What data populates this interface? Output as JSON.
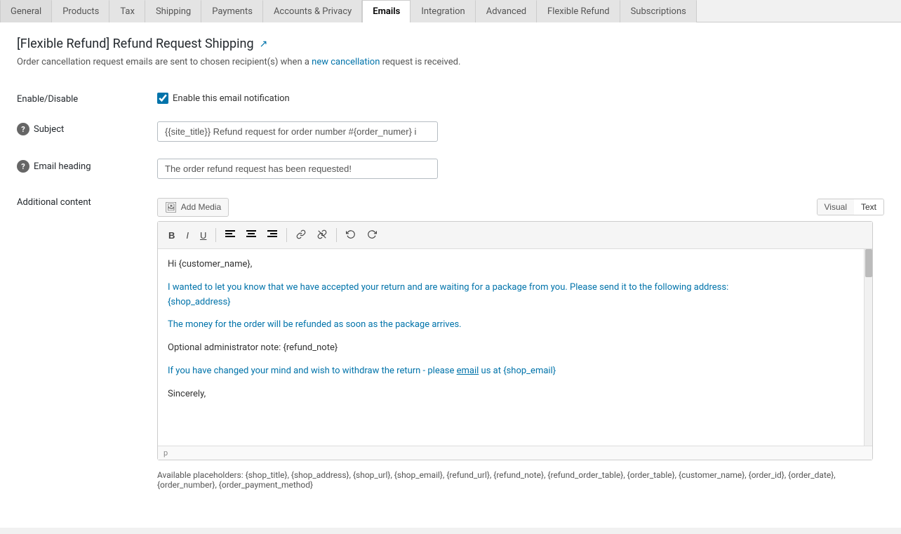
{
  "tabs": [
    {
      "id": "general",
      "label": "General",
      "active": false
    },
    {
      "id": "products",
      "label": "Products",
      "active": false
    },
    {
      "id": "tax",
      "label": "Tax",
      "active": false
    },
    {
      "id": "shipping",
      "label": "Shipping",
      "active": false
    },
    {
      "id": "payments",
      "label": "Payments",
      "active": false
    },
    {
      "id": "accounts-privacy",
      "label": "Accounts & Privacy",
      "active": false
    },
    {
      "id": "emails",
      "label": "Emails",
      "active": true
    },
    {
      "id": "integration",
      "label": "Integration",
      "active": false
    },
    {
      "id": "advanced",
      "label": "Advanced",
      "active": false
    },
    {
      "id": "flexible-refund",
      "label": "Flexible Refund",
      "active": false
    },
    {
      "id": "subscriptions",
      "label": "Subscriptions",
      "active": false
    }
  ],
  "page": {
    "title": "[Flexible Refund] Refund Request Shipping",
    "title_link_icon": "↗",
    "description": "Order cancellation request emails are sent to chosen recipient(s) when a new cancellation request is received."
  },
  "form": {
    "enable_disable": {
      "label": "Enable/Disable",
      "checkbox_label": "Enable this email notification",
      "checked": true
    },
    "subject": {
      "label": "Subject",
      "value": "{{site_title}} Refund request for order number #{order_numer} i",
      "placeholder": ""
    },
    "email_heading": {
      "label": "Email heading",
      "value": "The order refund request has been requested!",
      "placeholder": ""
    },
    "additional_content": {
      "label": "Additional content",
      "add_media_btn": "Add Media",
      "visual_tab": "Visual",
      "text_tab": "Text",
      "active_editor_tab": "Text",
      "editor_content": {
        "p1": "Hi {customer_name},",
        "p2": "I wanted to let you know that we have accepted your return and are waiting for a package from you. Please send it to the following address: {shop_address}",
        "p3": "The money for the order will be refunded as soon as the package arrives.",
        "p4": "Optional administrator note: {refund_note}",
        "p5": "If you have changed your mind and wish to withdraw the return - please email us at {shop_email}",
        "p6": "Sincerely,"
      },
      "status_bar": "p",
      "placeholders": "Available placeholders: {shop_title}, {shop_address}, {shop_url}, {shop_email}, {refund_url}, {refund_note}, {refund_order_table}, {order_table}, {customer_name}, {order_id}, {order_date}, {order_number}, {order_payment_method}"
    }
  },
  "toolbar": {
    "bold": "B",
    "italic": "I",
    "underline": "U",
    "align_left": "≡",
    "align_center": "≡",
    "align_right": "≡",
    "link": "🔗",
    "unlink": "⛓",
    "undo": "↩",
    "redo": "↪"
  }
}
